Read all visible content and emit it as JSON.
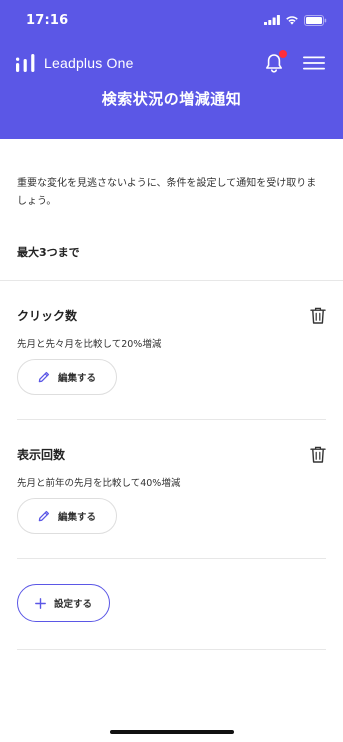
{
  "status_bar": {
    "time": "17:16"
  },
  "brand": {
    "name": "Leadplus One"
  },
  "header": {
    "title": "検索状況の増減通知"
  },
  "description": "重要な変化を見逃さないように、条件を設定して通知を受け取りましょう。",
  "limit_text": "最大3つまで",
  "notifications": [
    {
      "title": "クリック数",
      "condition": "先月と先々月を比較して20%増減",
      "edit_label": "編集する"
    },
    {
      "title": "表示回数",
      "condition": "先月と前年の先月を比較して40%増減",
      "edit_label": "編集する"
    }
  ],
  "add_button": {
    "label": "設定する"
  },
  "colors": {
    "primary": "#5b57e6",
    "badge": "#ff2d3b"
  },
  "icons": [
    "signal-icon",
    "wifi-icon",
    "battery-icon",
    "leadplus-logo-icon",
    "bell-icon",
    "menu-icon",
    "trash-icon",
    "pencil-icon",
    "plus-icon"
  ]
}
